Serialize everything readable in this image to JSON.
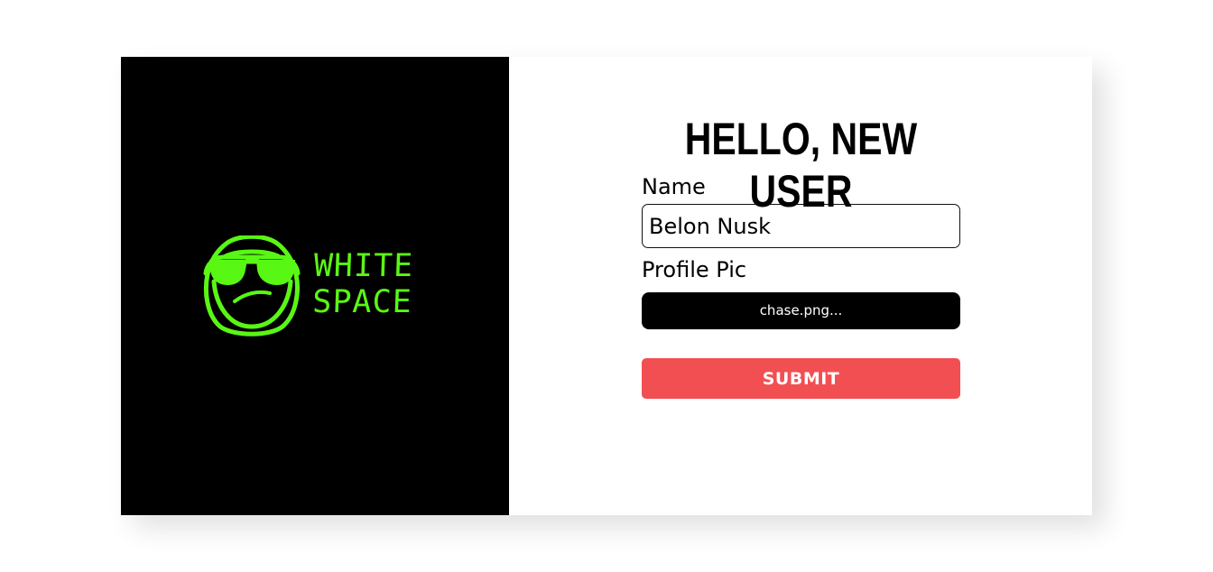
{
  "brand": {
    "name_line_1": "WHITE",
    "name_line_2": "SPACE",
    "mark_icon": "sunglasses-mascot-icon",
    "color": "#59f714"
  },
  "form": {
    "title": "HELLO, NEW USER",
    "name_label": "Name",
    "name_value": "Belon Nusk",
    "profile_label": "Profile Pic",
    "file_value": "chase.png...",
    "submit_label": "SUBMIT"
  },
  "colors": {
    "left_panel": "#000000",
    "accent_green": "#59f714",
    "submit": "#f24f52",
    "text": "#000000"
  }
}
